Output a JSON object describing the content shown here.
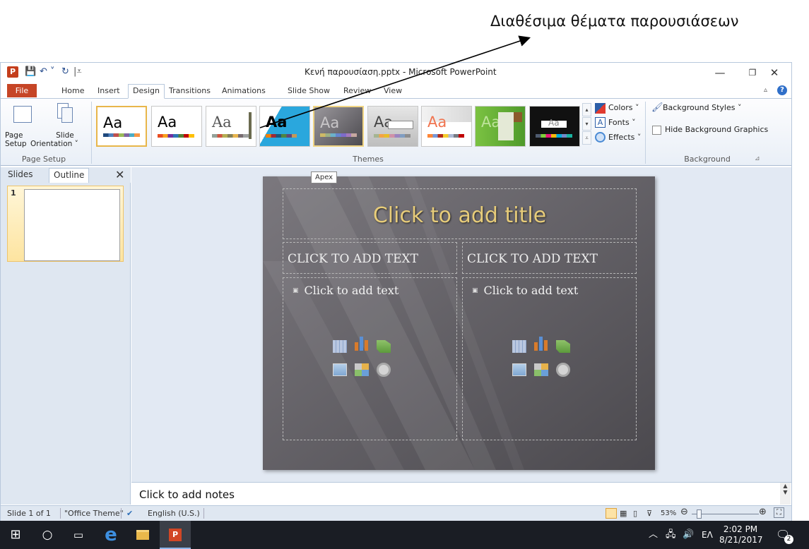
{
  "annotation": {
    "text": "Διαθέσιμα θέματα παρουσιάσεων"
  },
  "window": {
    "title": "Κενή παρουσίαση.pptx - Microsoft PowerPoint",
    "app_letter": "P"
  },
  "ribbon": {
    "file_tab": "File",
    "tabs": [
      "Home",
      "Insert",
      "Design",
      "Transitions",
      "Animations",
      "Slide Show",
      "Review",
      "View"
    ],
    "active_tab": "Design",
    "page_setup": {
      "group_label": "Page Setup",
      "page_setup_label_1": "Page",
      "page_setup_label_2": "Setup",
      "slide_orientation_label_1": "Slide",
      "slide_orientation_label_2": "Orientation ˅"
    },
    "themes": {
      "group_label": "Themes",
      "items": [
        {
          "label": "Aa",
          "name": "Office Theme"
        },
        {
          "label": "Aa",
          "name": ""
        },
        {
          "label": "Aa",
          "name": ""
        },
        {
          "label": "Aa",
          "name": ""
        },
        {
          "label": "Aa",
          "name": "Apex"
        },
        {
          "label": "Aa",
          "name": ""
        },
        {
          "label": "Aa",
          "name": ""
        },
        {
          "label": "Aa",
          "name": ""
        },
        {
          "label": "Aa",
          "name": ""
        }
      ],
      "colors_label": "Colors ˅",
      "fonts_label": "Fonts ˅",
      "effects_label": "Effects ˅"
    },
    "background": {
      "group_label": "Background",
      "background_styles_label": "Background Styles ˅",
      "hide_background_label": "Hide Background Graphics"
    }
  },
  "left_pane": {
    "tabs": [
      "Slides",
      "Outline"
    ],
    "close": "✕",
    "slide_number": "1"
  },
  "slide": {
    "tooltip": "Apex",
    "title": "Click to add title",
    "left_header": "CLICK TO ADD TEXT",
    "right_header": "CLICK TO ADD TEXT",
    "left_body": "Click to add text",
    "right_body": "Click to add text"
  },
  "notes": {
    "placeholder": "Click to add notes"
  },
  "statusbar": {
    "slide_count": "Slide 1 of 1",
    "theme": "\"Office Theme\"",
    "language": "English (U.S.)",
    "zoom": "53%"
  },
  "taskbar": {
    "language": "ΕΛ",
    "time": "2:02 PM",
    "date": "8/21/2017",
    "notification_count": "2"
  }
}
